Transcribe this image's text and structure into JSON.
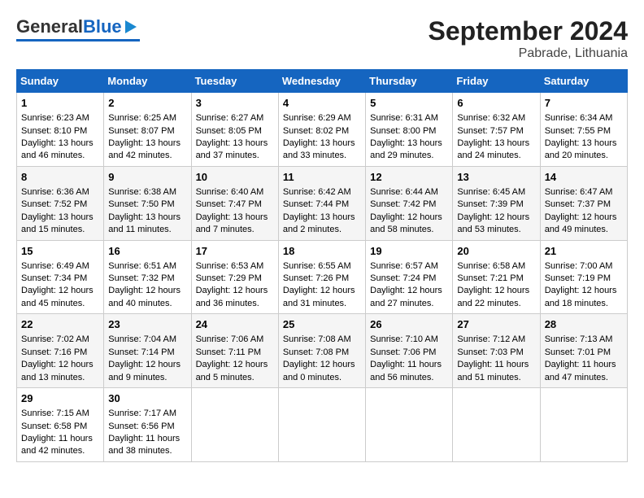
{
  "header": {
    "logo_general": "General",
    "logo_blue": "Blue",
    "title": "September 2024",
    "subtitle": "Pabrade, Lithuania"
  },
  "days_of_week": [
    "Sunday",
    "Monday",
    "Tuesday",
    "Wednesday",
    "Thursday",
    "Friday",
    "Saturday"
  ],
  "weeks": [
    [
      {
        "day": "1",
        "sunrise": "6:23 AM",
        "sunset": "8:10 PM",
        "daylight": "13 hours and 46 minutes."
      },
      {
        "day": "2",
        "sunrise": "6:25 AM",
        "sunset": "8:07 PM",
        "daylight": "13 hours and 42 minutes."
      },
      {
        "day": "3",
        "sunrise": "6:27 AM",
        "sunset": "8:05 PM",
        "daylight": "13 hours and 37 minutes."
      },
      {
        "day": "4",
        "sunrise": "6:29 AM",
        "sunset": "8:02 PM",
        "daylight": "13 hours and 33 minutes."
      },
      {
        "day": "5",
        "sunrise": "6:31 AM",
        "sunset": "8:00 PM",
        "daylight": "13 hours and 29 minutes."
      },
      {
        "day": "6",
        "sunrise": "6:32 AM",
        "sunset": "7:57 PM",
        "daylight": "13 hours and 24 minutes."
      },
      {
        "day": "7",
        "sunrise": "6:34 AM",
        "sunset": "7:55 PM",
        "daylight": "13 hours and 20 minutes."
      }
    ],
    [
      {
        "day": "8",
        "sunrise": "6:36 AM",
        "sunset": "7:52 PM",
        "daylight": "13 hours and 15 minutes."
      },
      {
        "day": "9",
        "sunrise": "6:38 AM",
        "sunset": "7:50 PM",
        "daylight": "13 hours and 11 minutes."
      },
      {
        "day": "10",
        "sunrise": "6:40 AM",
        "sunset": "7:47 PM",
        "daylight": "13 hours and 7 minutes."
      },
      {
        "day": "11",
        "sunrise": "6:42 AM",
        "sunset": "7:44 PM",
        "daylight": "13 hours and 2 minutes."
      },
      {
        "day": "12",
        "sunrise": "6:44 AM",
        "sunset": "7:42 PM",
        "daylight": "12 hours and 58 minutes."
      },
      {
        "day": "13",
        "sunrise": "6:45 AM",
        "sunset": "7:39 PM",
        "daylight": "12 hours and 53 minutes."
      },
      {
        "day": "14",
        "sunrise": "6:47 AM",
        "sunset": "7:37 PM",
        "daylight": "12 hours and 49 minutes."
      }
    ],
    [
      {
        "day": "15",
        "sunrise": "6:49 AM",
        "sunset": "7:34 PM",
        "daylight": "12 hours and 45 minutes."
      },
      {
        "day": "16",
        "sunrise": "6:51 AM",
        "sunset": "7:32 PM",
        "daylight": "12 hours and 40 minutes."
      },
      {
        "day": "17",
        "sunrise": "6:53 AM",
        "sunset": "7:29 PM",
        "daylight": "12 hours and 36 minutes."
      },
      {
        "day": "18",
        "sunrise": "6:55 AM",
        "sunset": "7:26 PM",
        "daylight": "12 hours and 31 minutes."
      },
      {
        "day": "19",
        "sunrise": "6:57 AM",
        "sunset": "7:24 PM",
        "daylight": "12 hours and 27 minutes."
      },
      {
        "day": "20",
        "sunrise": "6:58 AM",
        "sunset": "7:21 PM",
        "daylight": "12 hours and 22 minutes."
      },
      {
        "day": "21",
        "sunrise": "7:00 AM",
        "sunset": "7:19 PM",
        "daylight": "12 hours and 18 minutes."
      }
    ],
    [
      {
        "day": "22",
        "sunrise": "7:02 AM",
        "sunset": "7:16 PM",
        "daylight": "12 hours and 13 minutes."
      },
      {
        "day": "23",
        "sunrise": "7:04 AM",
        "sunset": "7:14 PM",
        "daylight": "12 hours and 9 minutes."
      },
      {
        "day": "24",
        "sunrise": "7:06 AM",
        "sunset": "7:11 PM",
        "daylight": "12 hours and 5 minutes."
      },
      {
        "day": "25",
        "sunrise": "7:08 AM",
        "sunset": "7:08 PM",
        "daylight": "12 hours and 0 minutes."
      },
      {
        "day": "26",
        "sunrise": "7:10 AM",
        "sunset": "7:06 PM",
        "daylight": "11 hours and 56 minutes."
      },
      {
        "day": "27",
        "sunrise": "7:12 AM",
        "sunset": "7:03 PM",
        "daylight": "11 hours and 51 minutes."
      },
      {
        "day": "28",
        "sunrise": "7:13 AM",
        "sunset": "7:01 PM",
        "daylight": "11 hours and 47 minutes."
      }
    ],
    [
      {
        "day": "29",
        "sunrise": "7:15 AM",
        "sunset": "6:58 PM",
        "daylight": "11 hours and 42 minutes."
      },
      {
        "day": "30",
        "sunrise": "7:17 AM",
        "sunset": "6:56 PM",
        "daylight": "11 hours and 38 minutes."
      },
      null,
      null,
      null,
      null,
      null
    ]
  ]
}
